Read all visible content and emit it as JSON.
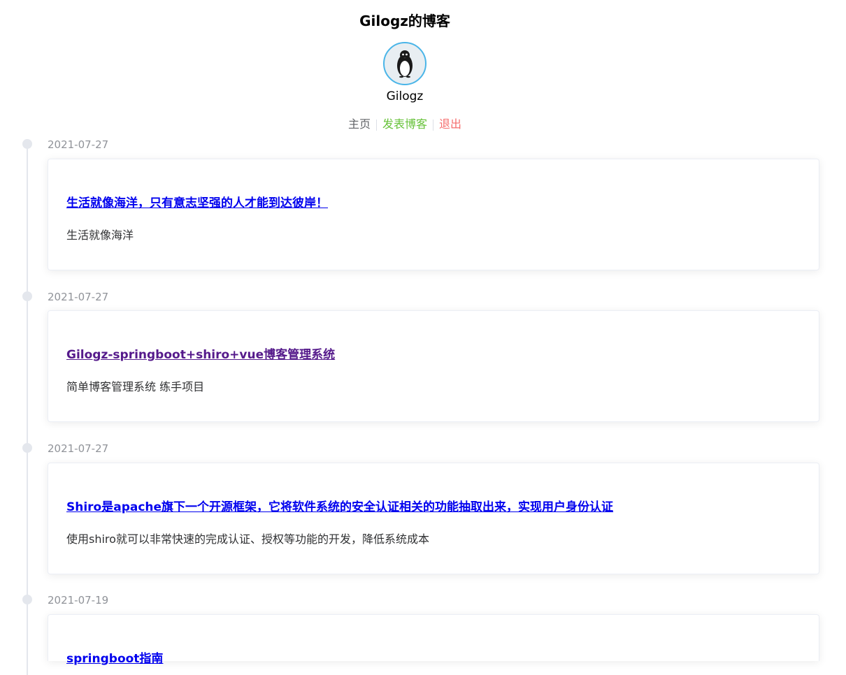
{
  "header": {
    "title": "Gilogz的博客",
    "username": "Gilogz"
  },
  "nav": {
    "home": "主页",
    "post": "发表博客",
    "logout": "退出"
  },
  "posts": [
    {
      "date": "2021-07-27",
      "title": "生活就像海洋，只有意志坚强的人才能到达彼岸！",
      "description": "生活就像海洋"
    },
    {
      "date": "2021-07-27",
      "title": "Gilogz-springboot+shiro+vue博客管理系统",
      "description": "简单博客管理系统 练手项目"
    },
    {
      "date": "2021-07-27",
      "title": "Shiro是apache旗下一个开源框架，它将软件系统的安全认证相关的功能抽取出来，实现用户身份认证",
      "description": "使用shiro就可以非常快速的完成认证、授权等功能的开发，降低系统成本"
    },
    {
      "date": "2021-07-19",
      "title": "springboot指南",
      "description": ""
    }
  ],
  "colors": {
    "accent_post": "#67c23a",
    "accent_logout": "#f56c6c",
    "link": "#0000ee",
    "link_visited": "#551a8b",
    "avatar_border": "#4ab5e8"
  }
}
